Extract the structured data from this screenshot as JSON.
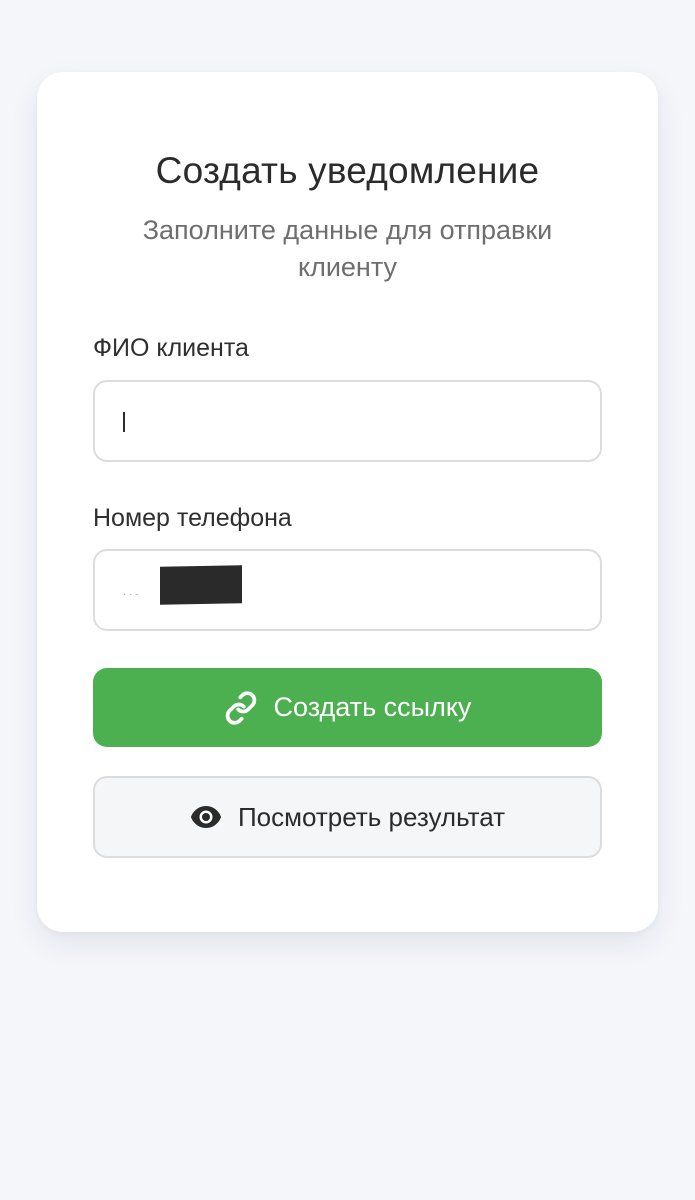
{
  "form": {
    "title": "Создать уведомление",
    "subtitle": "Заполните данные для отправки клиенту",
    "name_label": "ФИО клиента",
    "name_value": "",
    "phone_label": "Номер телефона",
    "phone_value": "",
    "create_link_label": "Создать ссылку",
    "view_result_label": "Посмотреть результат"
  },
  "icons": {
    "create_link": "link-icon",
    "view_result": "eye-icon"
  },
  "colors": {
    "primary": "#4caf50",
    "background": "#f4f6fa",
    "card": "#ffffff"
  }
}
